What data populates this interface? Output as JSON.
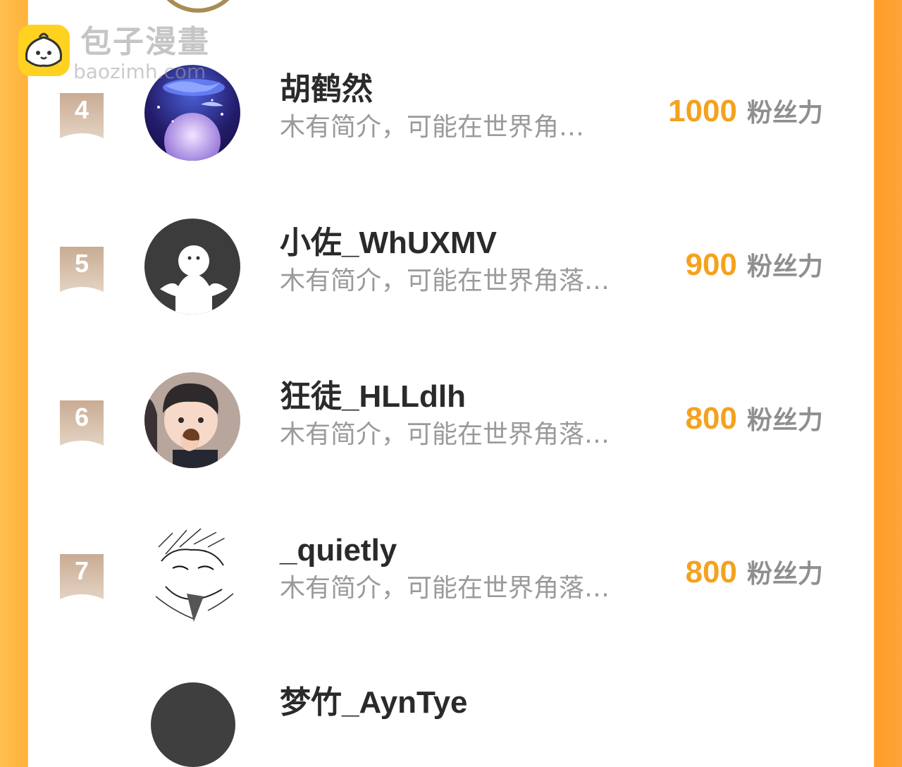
{
  "watermark": {
    "title": "包子漫畫",
    "url": "baozimh.com"
  },
  "colors": {
    "accent_orange": "#f4a21e",
    "side_orange": "#ffb23a",
    "rank_badge": "#cfb49e"
  },
  "fans_label": "粉丝力",
  "rows": [
    {
      "rank": "4",
      "name": "胡鹤然",
      "bio": "木有简介，可能在世界角…",
      "fans": "1000",
      "avatar_icon": "whale-moon-avatar-icon"
    },
    {
      "rank": "5",
      "name": "小佐_WhUXMV",
      "bio": "木有简介，可能在世界角落…",
      "fans": "900",
      "avatar_icon": "default-ghost-avatar-icon"
    },
    {
      "rank": "6",
      "name": "狂徒_HLLdlh",
      "bio": "木有简介，可能在世界角落…",
      "fans": "800",
      "avatar_icon": "cartoon-boy-avatar-icon"
    },
    {
      "rank": "7",
      "name": "_quietly",
      "bio": "木有简介，可能在世界角落…",
      "fans": "800",
      "avatar_icon": "sketch-manga-avatar-icon"
    }
  ],
  "next_row": {
    "name": "梦竹_AynTye"
  }
}
